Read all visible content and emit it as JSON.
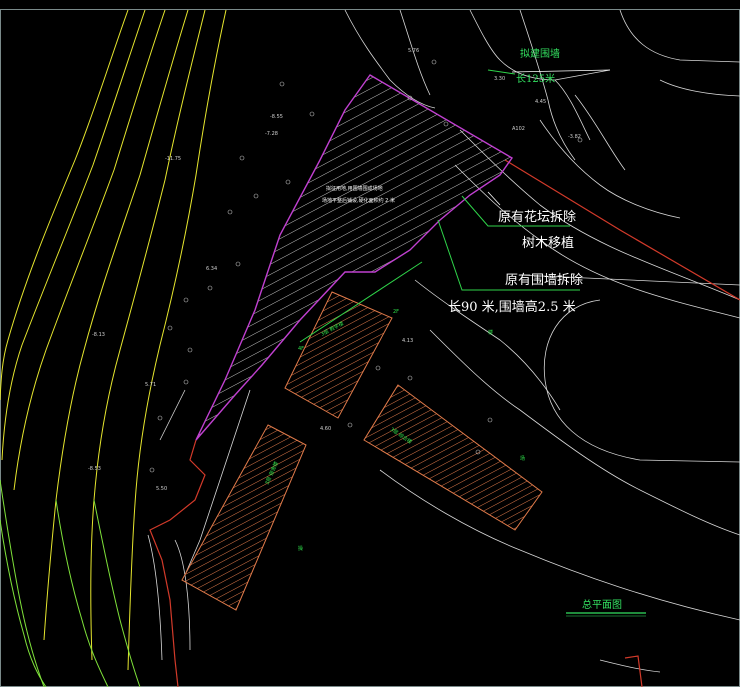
{
  "colors": {
    "background": "#000000",
    "border": "#7a8a8a",
    "contour_yellow": "#e6e62e",
    "contour_green": "#7fe23a",
    "plan_white": "#d8d8d8",
    "hatch_orange": "#e07a4a",
    "wall_red": "#d23a2a",
    "site_magenta": "#c040d0",
    "leader_green": "#2fd54a",
    "annotation_white": "#ffffff",
    "annotation_green": "#33e060"
  },
  "annotations": {
    "new_wall_title": "拟建围墙",
    "new_wall_length": "长125米",
    "flower_bed": "原有花坛拆除",
    "tree_relocate": "树木移植",
    "old_wall": "原有围墙拆除",
    "old_wall_spec": "长90 米,围墙高2.5 米",
    "drawing_title": "总平面图"
  },
  "small_text": {
    "site_note_1": "拟征用地,用围墙围成场地",
    "site_note_2": "场地平整后铺设,硬化面积约 2 米",
    "elev_1": "5.76",
    "elev_2": "3.30",
    "elev_3": "4.45",
    "elev_4": "-8.55",
    "elev_5": "-7.28",
    "elev_6": "-11.75",
    "elev_7": "6.34",
    "elev_8": "-8.13",
    "elev_9": "5.71",
    "elev_10": "-8.53",
    "elev_11": "5.50",
    "elev_12": "4.60",
    "elev_13": "4.13",
    "elev_14": "A102",
    "elev_15": "-3.82",
    "bld_1": "3层 教学楼",
    "bld_2": "3层 宿舍楼",
    "bld_3": "3层 综合楼",
    "bld_4": "2F",
    "bld_5": "楼",
    "bld_6": "场",
    "bld_7": "操",
    "bld_8": "4F"
  }
}
